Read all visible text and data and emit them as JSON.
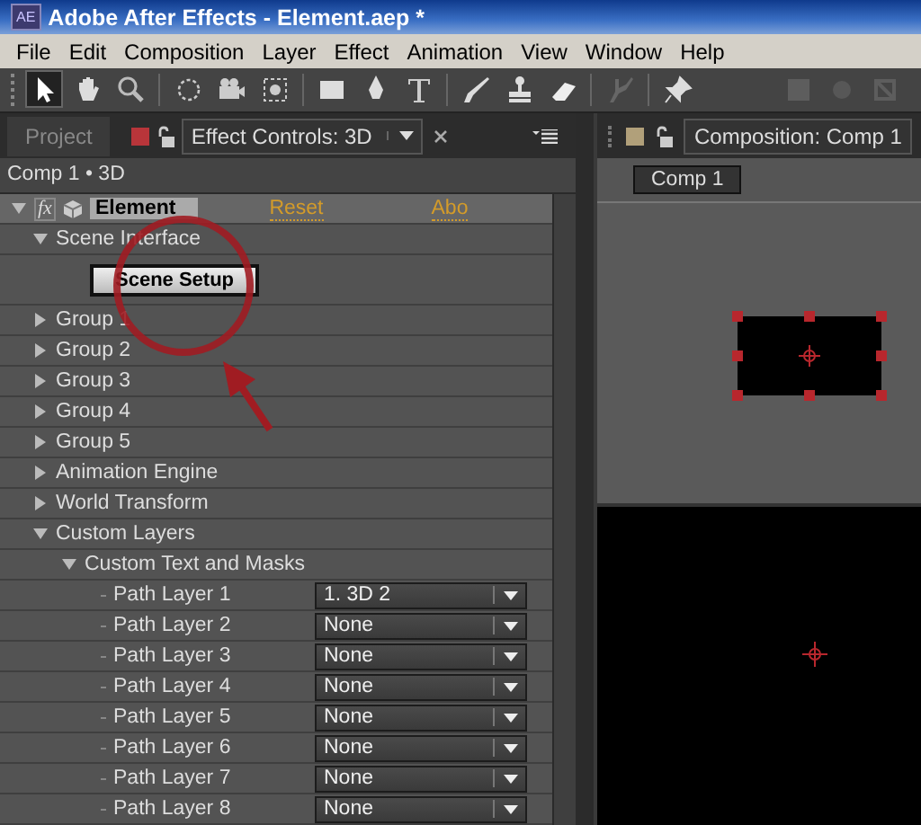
{
  "window": {
    "title": "Adobe After Effects - Element.aep *",
    "app_badge": "AE"
  },
  "menu": [
    "File",
    "Edit",
    "Composition",
    "Layer",
    "Effect",
    "Animation",
    "View",
    "Window",
    "Help"
  ],
  "toolbar": {
    "tools": [
      {
        "kind": "select",
        "selected": true,
        "disabled": false
      },
      {
        "kind": "hand",
        "selected": false,
        "disabled": false
      },
      {
        "kind": "zoom",
        "selected": false,
        "disabled": false
      },
      {
        "kind": "rotate",
        "selected": false,
        "disabled": false
      },
      {
        "kind": "camera",
        "selected": false,
        "disabled": false
      },
      {
        "kind": "panbehind",
        "selected": false,
        "disabled": false
      },
      {
        "kind": "rect",
        "selected": false,
        "disabled": false
      },
      {
        "kind": "pen",
        "selected": false,
        "disabled": false
      },
      {
        "kind": "type",
        "selected": false,
        "disabled": false
      },
      {
        "kind": "brush",
        "selected": false,
        "disabled": false
      },
      {
        "kind": "stamp",
        "selected": false,
        "disabled": false
      },
      {
        "kind": "eraser",
        "selected": false,
        "disabled": false
      },
      {
        "kind": "roto",
        "selected": false,
        "disabled": true
      },
      {
        "kind": "pin",
        "selected": false,
        "disabled": false
      },
      {
        "kind": "axis",
        "selected": false,
        "disabled": true
      },
      {
        "kind": "dot",
        "selected": false,
        "disabled": true
      },
      {
        "kind": "world",
        "selected": false,
        "disabled": true
      }
    ]
  },
  "left_panel": {
    "tabs": [
      {
        "label": "Project",
        "selected": false
      },
      {
        "label": "Effect Controls: 3D",
        "selected": true
      }
    ],
    "breadcrumb": "Comp 1 • 3D",
    "effect": {
      "fx": "fx",
      "expanded": true,
      "name": "Element",
      "reset": "Reset",
      "about": "Abo",
      "tree": [
        {
          "kind": "group",
          "label": "Scene Interface",
          "expanded": true,
          "children": [
            {
              "kind": "button",
              "label": "Scene Setup"
            }
          ]
        },
        {
          "kind": "group",
          "label": "Group 1",
          "expanded": false
        },
        {
          "kind": "group",
          "label": "Group 2",
          "expanded": false
        },
        {
          "kind": "group",
          "label": "Group 3",
          "expanded": false
        },
        {
          "kind": "group",
          "label": "Group 4",
          "expanded": false
        },
        {
          "kind": "group",
          "label": "Group 5",
          "expanded": false
        },
        {
          "kind": "group",
          "label": "Animation Engine",
          "expanded": false
        },
        {
          "kind": "group",
          "label": "World Transform",
          "expanded": false
        },
        {
          "kind": "group",
          "label": "Custom Layers",
          "expanded": true,
          "children": [
            {
              "kind": "group",
              "label": "Custom Text and Masks",
              "expanded": true,
              "children": [
                {
                  "kind": "dropdown",
                  "label": "Path Layer 1",
                  "value": "1. 3D 2"
                },
                {
                  "kind": "dropdown",
                  "label": "Path Layer 2",
                  "value": "None"
                },
                {
                  "kind": "dropdown",
                  "label": "Path Layer 3",
                  "value": "None"
                },
                {
                  "kind": "dropdown",
                  "label": "Path Layer 4",
                  "value": "None"
                },
                {
                  "kind": "dropdown",
                  "label": "Path Layer 5",
                  "value": "None"
                },
                {
                  "kind": "dropdown",
                  "label": "Path Layer 6",
                  "value": "None"
                },
                {
                  "kind": "dropdown",
                  "label": "Path Layer 7",
                  "value": "None"
                },
                {
                  "kind": "dropdown",
                  "label": "Path Layer 8",
                  "value": "None"
                }
              ]
            }
          ]
        }
      ]
    }
  },
  "right_panel": {
    "tab": "Composition: Comp 1",
    "comp_button": "Comp 1"
  }
}
